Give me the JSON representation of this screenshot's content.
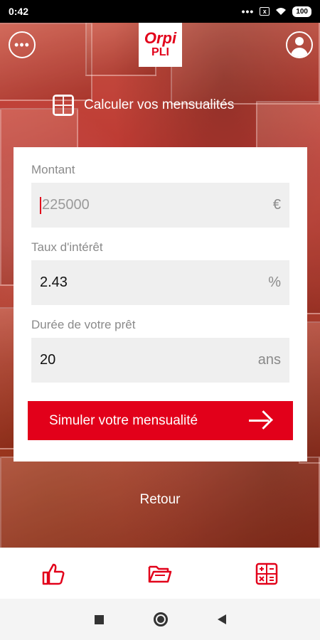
{
  "status_bar": {
    "time": "0:42",
    "dots": "•••",
    "sim_label": "x",
    "battery": "100"
  },
  "header": {
    "logo_top": "Orpi",
    "logo_bottom": "PLI",
    "menu_icon": "ellipsis-circle-icon",
    "user_icon": "user-circle-icon"
  },
  "heading": {
    "title": "Calculer vos mensualités",
    "icon": "calculator-icon"
  },
  "form": {
    "amount": {
      "label": "Montant",
      "placeholder": "225000",
      "value": "",
      "unit": "€"
    },
    "rate": {
      "label": "Taux d'intérêt",
      "value": "2.43",
      "unit": "%"
    },
    "duration": {
      "label": "Durée de votre prêt",
      "value": "20",
      "unit": "ans"
    },
    "submit_label": "Simuler votre mensualité"
  },
  "back_label": "Retour",
  "bottom_tabs": [
    {
      "icon": "thumbs-up-icon"
    },
    {
      "icon": "folder-open-icon"
    },
    {
      "icon": "calculator-icon"
    }
  ],
  "colors": {
    "brand": "#e2001a",
    "overlay": "#c8493c"
  }
}
